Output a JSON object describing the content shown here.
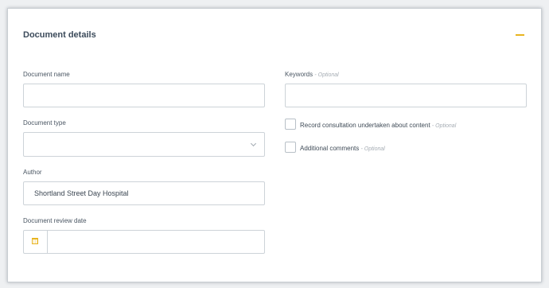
{
  "section": {
    "title": "Document details"
  },
  "fields": {
    "document_name": {
      "label": "Document name",
      "value": ""
    },
    "document_type": {
      "label": "Document type",
      "value": ""
    },
    "author": {
      "label": "Author",
      "value": "Shortland Street Day Hospital"
    },
    "review_date": {
      "label": "Document review date",
      "value": ""
    },
    "keywords": {
      "label": "Keywords",
      "optional": "- Optional",
      "value": ""
    }
  },
  "checkboxes": [
    {
      "label": "Record consultation undertaken about content",
      "optional": "- Optional",
      "checked": false
    },
    {
      "label": "Additional comments",
      "optional": "- Optional",
      "checked": false
    }
  ],
  "icons": {
    "collapse": "minus-icon",
    "dropdown": "chevron-down-icon",
    "date": "calendar-icon"
  },
  "colors": {
    "accent": "#e8b420",
    "title": "#3b4a5a",
    "border": "#cdd3d8"
  }
}
